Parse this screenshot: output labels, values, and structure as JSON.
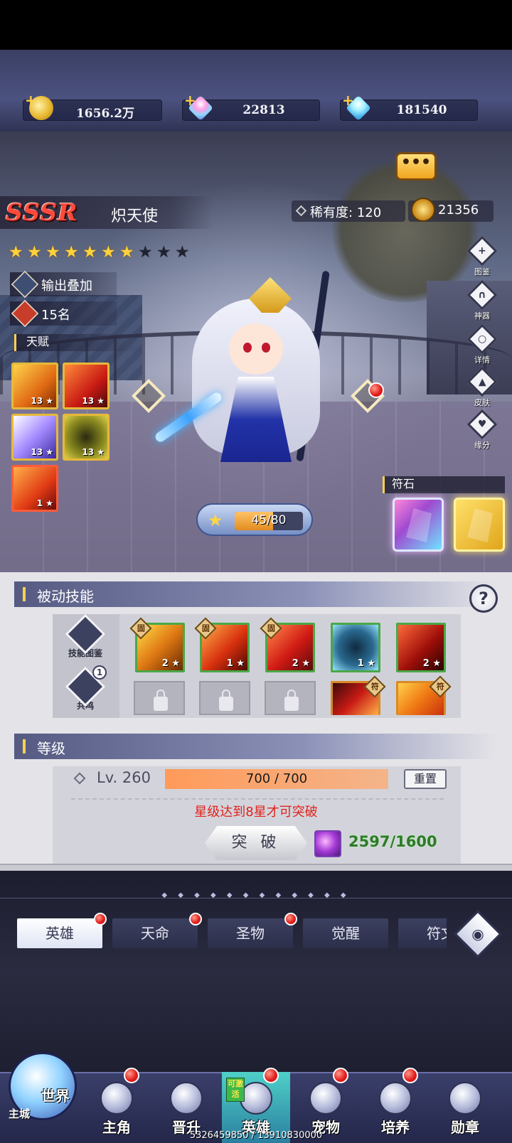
{
  "currencies": [
    {
      "name": "gold",
      "value": "1656.2万"
    },
    {
      "name": "gem",
      "value": "22813"
    },
    {
      "name": "diamond",
      "value": "181540"
    }
  ],
  "hero": {
    "rarity_grade": "SSSR",
    "name": "炽天使",
    "rarity_label": "稀有度:",
    "rarity_value": "120",
    "power": "21356",
    "stars_total": 10,
    "stars_filled": 7,
    "role": "输出叠加",
    "rank": "15名",
    "talent_label": "天赋",
    "talents": [
      {
        "level": "13"
      },
      {
        "level": "13"
      },
      {
        "level": "13"
      },
      {
        "level": "13"
      },
      {
        "level": "1"
      }
    ],
    "exp": {
      "text": "45/80",
      "fraction": 0.5625
    }
  },
  "side_menu": [
    "图鉴",
    "神器",
    "详情",
    "皮肤",
    "缘分"
  ],
  "rune": {
    "label": "符石"
  },
  "passive": {
    "title": "被动技能",
    "help": "?",
    "codex_label": "技能图鉴",
    "resonance_label": "共鸣",
    "resonance_count": "1",
    "fixed_tag": "固",
    "rune_tag": "符",
    "skills": [
      {
        "level": "2",
        "fixed": true
      },
      {
        "level": "1",
        "fixed": true
      },
      {
        "level": "2",
        "fixed": true
      },
      {
        "level": "1",
        "fixed": false
      },
      {
        "level": "2",
        "fixed": false
      }
    ]
  },
  "level": {
    "title": "等级",
    "lv_text": "Lv. 260",
    "exp_text": "700 / 700",
    "exp_fraction": 1.0,
    "reset": "重置",
    "warning": "星级达到8星才可突破",
    "break_button": "突 破",
    "material": "2597/1600"
  },
  "tabs": [
    {
      "label": "英雄",
      "active": true,
      "dot": true
    },
    {
      "label": "天命",
      "active": false,
      "dot": true
    },
    {
      "label": "圣物",
      "active": false,
      "dot": true
    },
    {
      "label": "觉醒",
      "active": false,
      "dot": false
    },
    {
      "label": "符文",
      "active": false,
      "dot": false
    }
  ],
  "nav": {
    "world": "世界",
    "main_city": "主城",
    "items": [
      {
        "label": "主角",
        "dot": true
      },
      {
        "label": "晋升",
        "dot": false
      },
      {
        "label": "英雄",
        "dot": true,
        "active": true,
        "badge": "可激活"
      },
      {
        "label": "宠物",
        "dot": true
      },
      {
        "label": "培养",
        "dot": true
      },
      {
        "label": "勋章",
        "dot": false
      }
    ]
  },
  "footer": "5326459850 / 13910830000",
  "colors": {
    "accent_gold": "#ffd24a",
    "warning_red": "#e0221c",
    "resource_green": "#2f7a2a",
    "sssr_red": "#ff4a3b"
  }
}
